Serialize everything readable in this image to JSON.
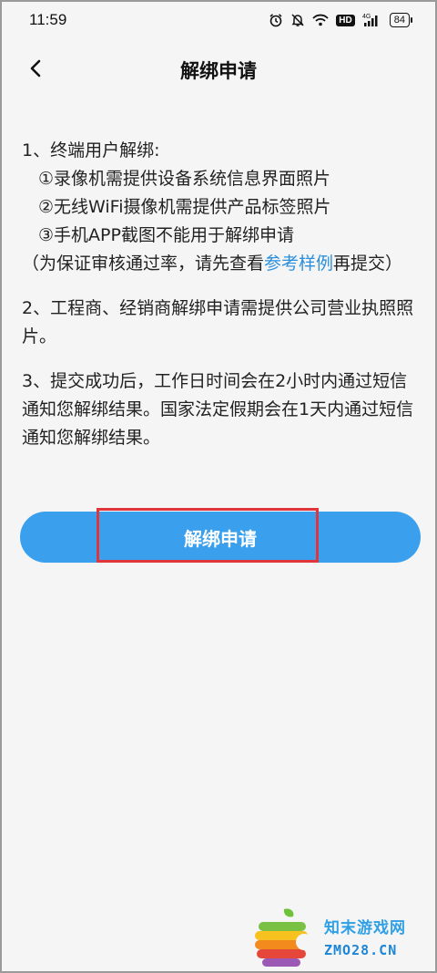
{
  "status_bar": {
    "time": "11:59",
    "icons": [
      "alarm-icon",
      "mute-icon",
      "wifi-icon",
      "hd-icon",
      "signal-4g-icon",
      "battery-icon"
    ],
    "hd_label": "HD",
    "network_label": "4G",
    "battery_level": "84"
  },
  "header": {
    "title": "解绑申请",
    "back_icon": "chevron-left-icon"
  },
  "content": {
    "item1_title": "1、终端用户解绑:",
    "item1_sub1": "①录像机需提供设备系统信息界面照片",
    "item1_sub2": "②无线WiFi摄像机需提供产品标签照片",
    "item1_sub3": "③手机APP截图不能用于解绑申请",
    "item1_note_prefix": "（为保证审核通过率，请先查看",
    "item1_note_link": "参考样例",
    "item1_note_suffix": "再提交）",
    "item2": "2、工程商、经销商解绑申请需提供公司营业执照照片。",
    "item3": "3、提交成功后，工作日时间会在2小时内通过短信通知您解绑结果。国家法定假期会在1天内通过短信通知您解绑结果。"
  },
  "button": {
    "label": "解绑申请"
  },
  "colors": {
    "accent": "#3aa0ee",
    "link": "#2b8fdb",
    "highlight": "#e0353b",
    "background": "#f5f5f5"
  },
  "watermark": {
    "name": "知末游戏网",
    "domain": "ZMO28.CN"
  }
}
